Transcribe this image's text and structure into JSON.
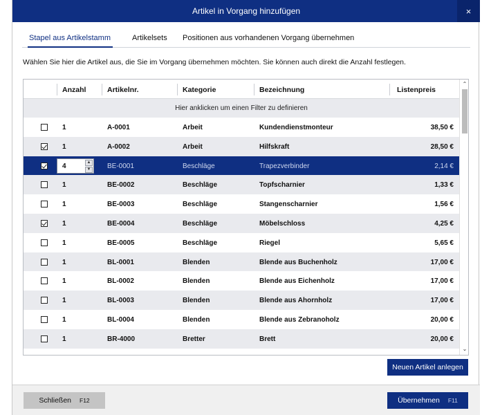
{
  "window": {
    "title": "Artikel in Vorgang hinzufügen",
    "close_label": "×"
  },
  "tabs": [
    {
      "label": "Stapel aus Artikelstamm",
      "active": true
    },
    {
      "label": "Artikelsets",
      "active": false
    },
    {
      "label": "Positionen aus vorhandenen Vorgang übernehmen",
      "active": false
    }
  ],
  "intro": "Wählen Sie hier die Artikel aus, die Sie im Vorgang übernehmen möchten. Sie können auch direkt die Anzahl festlegen.",
  "grid": {
    "columns": [
      "Anzahl",
      "Artikelnr.",
      "Kategorie",
      "Bezeichnung",
      "Listenpreis"
    ],
    "filter_hint": "Hier anklicken um einen Filter zu definieren",
    "rows": [
      {
        "checked": false,
        "qty": "1",
        "nr": "A-0001",
        "kategorie": "Arbeit",
        "bezeichnung": "Kundendienstmonteur",
        "preis": "38,50 €"
      },
      {
        "checked": true,
        "qty": "1",
        "nr": "A-0002",
        "kategorie": "Arbeit",
        "bezeichnung": "Hilfskraft",
        "preis": "28,50 €"
      },
      {
        "checked": true,
        "qty": "4",
        "nr": "BE-0001",
        "kategorie": "Beschläge",
        "bezeichnung": "Trapezverbinder",
        "preis": "2,14 €",
        "selected": true
      },
      {
        "checked": false,
        "qty": "1",
        "nr": "BE-0002",
        "kategorie": "Beschläge",
        "bezeichnung": "Topfscharnier",
        "preis": "1,33 €"
      },
      {
        "checked": false,
        "qty": "1",
        "nr": "BE-0003",
        "kategorie": "Beschläge",
        "bezeichnung": "Stangenscharnier",
        "preis": "1,56 €"
      },
      {
        "checked": true,
        "qty": "1",
        "nr": "BE-0004",
        "kategorie": "Beschläge",
        "bezeichnung": "Möbelschloss",
        "preis": "4,25 €"
      },
      {
        "checked": false,
        "qty": "1",
        "nr": "BE-0005",
        "kategorie": "Beschläge",
        "bezeichnung": "Riegel",
        "preis": "5,65 €"
      },
      {
        "checked": false,
        "qty": "1",
        "nr": "BL-0001",
        "kategorie": "Blenden",
        "bezeichnung": "Blende aus Buchenholz",
        "preis": "17,00 €"
      },
      {
        "checked": false,
        "qty": "1",
        "nr": "BL-0002",
        "kategorie": "Blenden",
        "bezeichnung": "Blende aus Eichenholz",
        "preis": "17,00 €"
      },
      {
        "checked": false,
        "qty": "1",
        "nr": "BL-0003",
        "kategorie": "Blenden",
        "bezeichnung": "Blende aus Ahornholz",
        "preis": "17,00 €"
      },
      {
        "checked": false,
        "qty": "1",
        "nr": "BL-0004",
        "kategorie": "Blenden",
        "bezeichnung": "Blende aus Zebranoholz",
        "preis": "20,00 €"
      },
      {
        "checked": false,
        "qty": "1",
        "nr": "BR-4000",
        "kategorie": "Bretter",
        "bezeichnung": "Brett",
        "preis": "20,00 €"
      }
    ]
  },
  "buttons": {
    "new_article": "Neuen Artikel anlegen",
    "close": "Schließen",
    "close_key": "F12",
    "apply": "Übernehmen",
    "apply_key": "F11"
  },
  "icons": {
    "spin_up": "▲",
    "spin_down": "▼",
    "scroll_up": "⌃",
    "scroll_down": "⌄"
  },
  "colors": {
    "accent": "#0f2f82",
    "row_alt": "#e9eaee"
  }
}
